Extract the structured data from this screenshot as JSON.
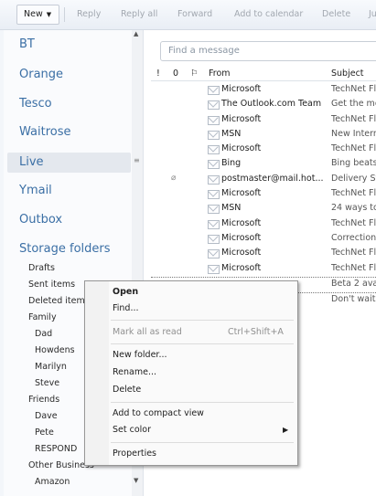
{
  "toolbar": {
    "new_label": "New",
    "reply_label": "Reply",
    "reply_all_label": "Reply all",
    "forward_label": "Forward",
    "add_calendar_label": "Add to calendar",
    "delete_label": "Delete",
    "junk_label": "Ju"
  },
  "sidebar": {
    "accounts": [
      "BT",
      "Orange",
      "Tesco",
      "Waitrose",
      "Live",
      "Ymail",
      "Outbox",
      "Storage folders"
    ],
    "folders": [
      "Drafts",
      "Sent items",
      "Deleted items",
      "Family",
      "Dad",
      "Howdens",
      "Marilyn",
      "Steve",
      "Friends",
      "Dave",
      "Pete",
      "RESPOND",
      "Other Business",
      "Amazon"
    ]
  },
  "search": {
    "placeholder": "Find a message"
  },
  "list": {
    "headers": {
      "flag1": "!",
      "attach": "0",
      "flag2": "⚐",
      "from": "From",
      "subject": "Subject"
    },
    "rows": [
      {
        "from": "Microsoft",
        "subject": "TechNet Fl"
      },
      {
        "from": "The Outlook.com Team",
        "subject": "Get the mo"
      },
      {
        "from": "Microsoft",
        "subject": "TechNet Fl"
      },
      {
        "from": "MSN",
        "subject": "New Intern"
      },
      {
        "from": "Microsoft",
        "subject": "TechNet Fl"
      },
      {
        "from": "Bing",
        "subject": "Bing beats"
      },
      {
        "from": "postmaster@mail.hot...",
        "subject": "Delivery Sta"
      },
      {
        "from": "Microsoft",
        "subject": "TechNet Fl"
      },
      {
        "from": "MSN",
        "subject": "24 ways to"
      },
      {
        "from": "Microsoft",
        "subject": "TechNet Fl"
      },
      {
        "from": "Microsoft",
        "subject": "Correction"
      },
      {
        "from": "Microsoft",
        "subject": "TechNet Fl"
      },
      {
        "from": "Microsoft",
        "subject": "TechNet Fl"
      },
      {
        "from": "",
        "subject": "Beta 2 avail"
      },
      {
        "from": "",
        "subject": "Don't wait!"
      }
    ]
  },
  "context_menu": {
    "open": "Open",
    "find": "Find...",
    "mark_all_read": "Mark all as read",
    "mark_all_read_shortcut": "Ctrl+Shift+A",
    "new_folder": "New folder...",
    "rename": "Rename...",
    "delete": "Delete",
    "add_compact": "Add to compact view",
    "set_color": "Set color",
    "properties": "Properties"
  }
}
